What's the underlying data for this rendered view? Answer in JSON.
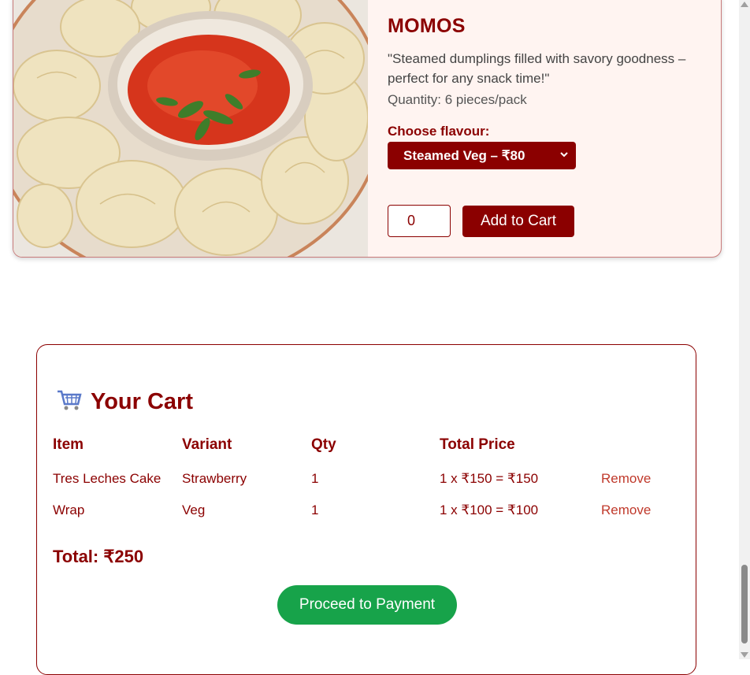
{
  "product": {
    "title": "MOMOS",
    "description": "\"Steamed dumplings filled with savory goodness – perfect for any snack time!\"",
    "quantity_info": "Quantity: 6 pieces/pack",
    "flavour_label": "Choose flavour:",
    "flavour_selected": "Steamed Veg – ₹80",
    "qty_value": "0",
    "add_to_cart_label": "Add to Cart",
    "image_icon": "momos-plate-image"
  },
  "cart": {
    "title": "Your Cart",
    "icon": "shopping-cart-icon",
    "headers": [
      "Item",
      "Variant",
      "Qty",
      "Total Price"
    ],
    "rows": [
      {
        "item": "Tres Leches Cake",
        "variant": "Strawberry",
        "qty": "1",
        "total": "1 x ₹150 = ₹150",
        "action": "Remove"
      },
      {
        "item": "Wrap",
        "variant": "Veg",
        "qty": "1",
        "total": "1 x ₹100 = ₹100",
        "action": "Remove"
      }
    ],
    "total": "Total: ₹250",
    "pay_label": "Proceed to Payment"
  },
  "colors": {
    "accent": "#8b0000",
    "pay_button": "#17a34a",
    "remove_link": "#c0392b"
  }
}
